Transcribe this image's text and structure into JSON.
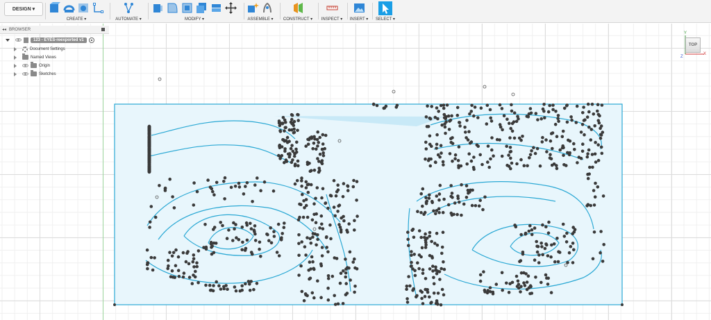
{
  "toolbar": {
    "workspace": "DESIGN",
    "groups": [
      {
        "label": "CREATE ▾"
      },
      {
        "label": "AUTOMATE ▾"
      },
      {
        "label": "MODIFY ▾"
      },
      {
        "label": "ASSEMBLE ▾"
      },
      {
        "label": "CONSTRUCT ▾"
      },
      {
        "label": "INSPECT ▾"
      },
      {
        "label": "INSERT ▾"
      },
      {
        "label": "SELECT ▾"
      }
    ]
  },
  "browser": {
    "title": "BROWSER",
    "root": "123 - EYES-reexported v1",
    "items": [
      {
        "label": "Document Settings"
      },
      {
        "label": "Named Views"
      },
      {
        "label": "Origin"
      },
      {
        "label": "Sketches"
      }
    ]
  },
  "viewcube": {
    "face": "TOP",
    "axis_x": "X",
    "axis_y": "Y",
    "axis_z": "Z"
  },
  "colors": {
    "sketch_line": "#2aa8d4",
    "sketch_fill": "#e6f5fb",
    "points": "#3a3a3a",
    "accent": "#1a9ee6"
  }
}
